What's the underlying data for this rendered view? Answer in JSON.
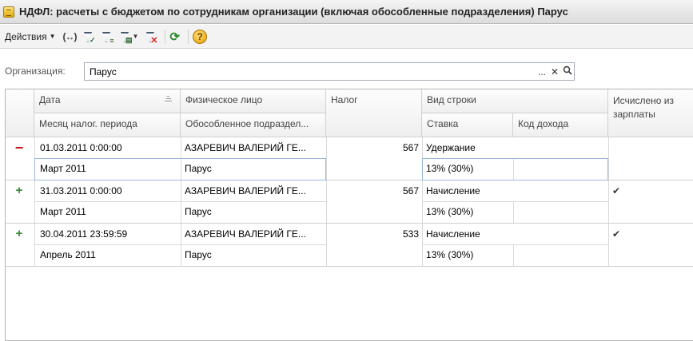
{
  "window": {
    "title": "НДФЛ: расчеты с бюджетом по сотрудникам организации (включая обособленные подразделения) Парус"
  },
  "toolbar": {
    "actions_label": "Действия",
    "buttons": [
      "swap-icon",
      "filter-icon",
      "filter-settings-icon",
      "filter-list-icon",
      "filter-clear-icon",
      "refresh-icon",
      "help-icon"
    ],
    "help_glyph": "?"
  },
  "organization": {
    "label": "Организация:",
    "value": "Парус",
    "select_glyph": "...",
    "clear_glyph": "✕",
    "search_glyph": "⚲"
  },
  "table": {
    "columns": {
      "date": "Дата",
      "month": "Месяц налог. периода",
      "person": "Физическое лицо",
      "subdivision": "Обособленное подраздел...",
      "tax": "Налог",
      "row_type": "Вид строки",
      "rate": "Ставка",
      "income_code": "Код дохода",
      "from_salary": "Исчислено из зарплаты"
    },
    "rows": [
      {
        "sign": "−",
        "sign_type": "minus",
        "date": "01.03.2011 0:00:00",
        "month": "Март 2011",
        "person": "АЗАРЕВИЧ ВАЛЕРИЙ ГЕ...",
        "subdivision": "Парус",
        "tax": "567",
        "row_type": "Удержание",
        "rate": "13% (30%)",
        "income_code": "",
        "from_salary": ""
      },
      {
        "sign": "+",
        "sign_type": "plus",
        "date": "31.03.2011 0:00:00",
        "month": "Март 2011",
        "person": "АЗАРЕВИЧ ВАЛЕРИЙ ГЕ...",
        "subdivision": "Парус",
        "tax": "567",
        "row_type": "Начисление",
        "rate": "13% (30%)",
        "income_code": "",
        "from_salary": "✔"
      },
      {
        "sign": "+",
        "sign_type": "plus",
        "date": "30.04.2011 23:59:59",
        "month": "Апрель 2011",
        "person": "АЗАРЕВИЧ ВАЛЕРИЙ ГЕ...",
        "subdivision": "Парус",
        "tax": "533",
        "row_type": "Начисление",
        "rate": "13% (30%)",
        "income_code": "",
        "from_salary": "✔"
      }
    ]
  }
}
